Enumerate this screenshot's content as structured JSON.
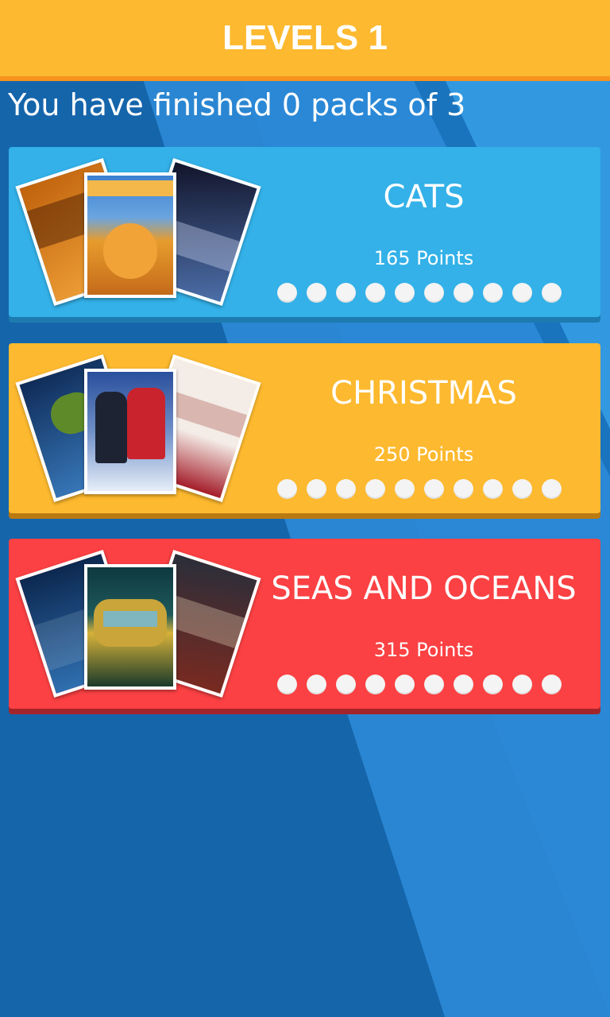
{
  "header": {
    "title": "LEVELS 1"
  },
  "progress_text": "You have finished 0 packs of 3",
  "packs": [
    {
      "name": "CATS",
      "points": "165 Points",
      "color": "#33b1e8",
      "shadow_color": "#1d7bb0",
      "levels_total": 10,
      "levels_completed": 0,
      "poster_colors": {
        "left": [
          "#c0620d",
          "#f2a53b"
        ],
        "center": [
          "#3b7fcf",
          "#e79c2c"
        ],
        "right": [
          "#12142a",
          "#4c6ea8"
        ]
      }
    },
    {
      "name": "CHRISTMAS",
      "points": "250 Points",
      "color": "#fdb92f",
      "shadow_color": "#b97a12",
      "levels_total": 10,
      "levels_completed": 0,
      "poster_colors": {
        "left": [
          "#0f2b57",
          "#3a7dc0"
        ],
        "center": [
          "#2a4f9c",
          "#e6eef8"
        ],
        "right": [
          "#f4ece6",
          "#a41d2a"
        ]
      }
    },
    {
      "name": "SEAS AND OCEANS",
      "points": "315 Points",
      "color": "#fb4143",
      "shadow_color": "#a2252b",
      "levels_total": 10,
      "levels_completed": 0,
      "poster_colors": {
        "left": [
          "#0c2850",
          "#2f6fb0"
        ],
        "center": [
          "#0e3840",
          "#d6b23a"
        ],
        "right": [
          "#2a2e3a",
          "#7a2a20"
        ]
      }
    }
  ]
}
